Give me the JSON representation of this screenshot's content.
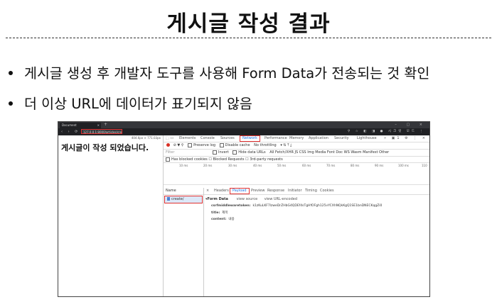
{
  "slide": {
    "title": "게시글 작성 결과",
    "bullets": [
      "게시글 생성 후 개발자 도구를 사용해 Form Data가 전송되는 것 확인",
      "더 이상 URL에 데이터가 표기되지 않음"
    ]
  },
  "browser": {
    "tab_title": "Document",
    "tab_close": "×",
    "new_tab": "+",
    "window_controls": "– ▢ ×",
    "nav": "‹ › ⟳",
    "url": "127.0.0.1:8000/articles/create/",
    "addr_icons": "⚲ ☆ ◧ ◨ ● 시크릿 모드 ⋮"
  },
  "page": {
    "dims": "404.6px × 771.03px",
    "heading": "게시글이 작성 되었습니다."
  },
  "devtools": {
    "tabs": [
      "Elements",
      "Console",
      "Sources",
      "Network",
      "Performance",
      "Memory",
      "Application",
      "Security",
      "Lighthouse"
    ],
    "active_tab": "Network",
    "right_icons": "» ▣1 ⚙ ⋮ ×",
    "toolbar": {
      "preserve_log": "Preserve log",
      "disable_cache": "Disable cache",
      "throttling": "No throttling"
    },
    "filter": {
      "placeholder": "Filter",
      "invert": "Invert",
      "hide_data_urls": "Hide data URLs",
      "types": "All  Fetch/XHR  JS  CSS  Img  Media  Font  Doc  WS  Wasm  Manifest  Other"
    },
    "row3": "Has blocked cookies  ☐ Blocked Requests  ☐ 3rd-party requests",
    "timeline_ticks": [
      "10 ms",
      "20 ms",
      "30 ms",
      "40 ms",
      "50 ms",
      "60 ms",
      "70 ms",
      "80 ms",
      "90 ms",
      "100 ms",
      "110"
    ],
    "names_header": "Name",
    "request_name": "create/",
    "detail_close": "×",
    "detail_tabs": [
      "Headers",
      "Payload",
      "Preview",
      "Response",
      "Initiator",
      "Timing",
      "Cookies"
    ],
    "active_detail_tab": "Payload",
    "form_data": {
      "label": "▾Form Data",
      "view_source": "view source",
      "view_url_encoded": "view URL-encoded",
      "fields": [
        {
          "key": "csrfmiddlewaretoken:",
          "value": "k1zKuLKF7lzweDrZHbG4QDEf4sTgHfOFgh125vYCXhNQkKgQ1SE1bnDNECKqgZi0"
        },
        {
          "key": "title:",
          "value": "제목"
        },
        {
          "key": "content:",
          "value": "내용"
        }
      ]
    }
  }
}
